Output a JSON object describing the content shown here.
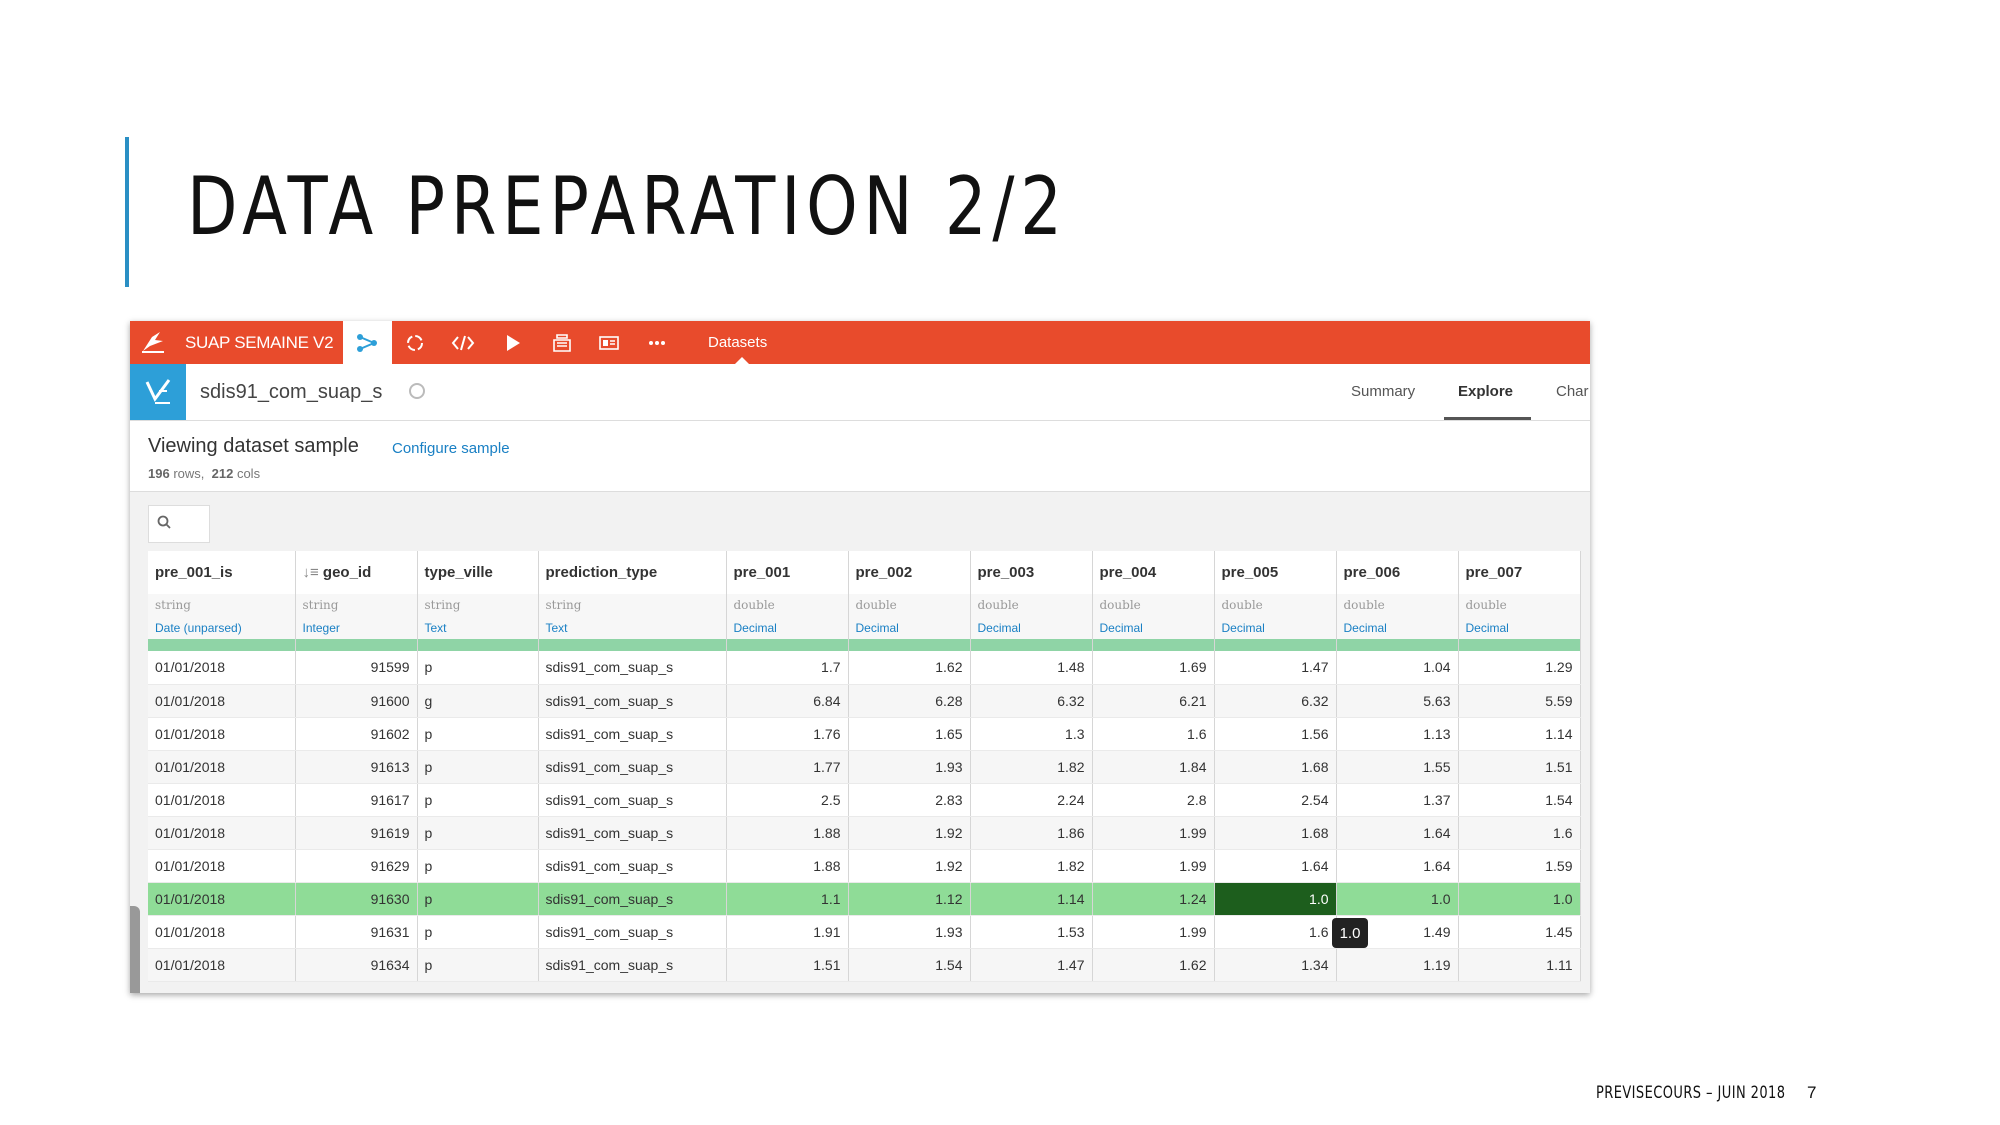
{
  "slide": {
    "title": "DATA PREPARATION 2/2",
    "footer": "PREVISECOURS – JUIN 2018",
    "page": "7"
  },
  "topbar": {
    "project": "SUAP SEMAINE V2",
    "datasets_label": "Datasets",
    "color": "#e84b2c"
  },
  "dataset": {
    "name": "sdis91_com_suap_s",
    "tabs": [
      "Summary",
      "Explore",
      "Char"
    ],
    "active_tab": "Explore"
  },
  "sample": {
    "title": "Viewing dataset sample",
    "configure_label": "Configure sample",
    "rows_count": "196",
    "rows_label": "rows,",
    "cols_count": "212",
    "cols_label": "cols"
  },
  "columns": [
    {
      "name": "pre_001_is",
      "type": "string",
      "meaning": "Date (unparsed)"
    },
    {
      "name": "geo_id",
      "type": "string",
      "meaning": "Integer"
    },
    {
      "name": "type_ville",
      "type": "string",
      "meaning": "Text"
    },
    {
      "name": "prediction_type",
      "type": "string",
      "meaning": "Text"
    },
    {
      "name": "pre_001",
      "type": "double",
      "meaning": "Decimal"
    },
    {
      "name": "pre_002",
      "type": "double",
      "meaning": "Decimal"
    },
    {
      "name": "pre_003",
      "type": "double",
      "meaning": "Decimal"
    },
    {
      "name": "pre_004",
      "type": "double",
      "meaning": "Decimal"
    },
    {
      "name": "pre_005",
      "type": "double",
      "meaning": "Decimal"
    },
    {
      "name": "pre_006",
      "type": "double",
      "meaning": "Decimal"
    },
    {
      "name": "pre_007",
      "type": "double",
      "meaning": "Decimal"
    }
  ],
  "rows": [
    [
      "01/01/2018",
      "91599",
      "p",
      "sdis91_com_suap_s",
      "1.7",
      "1.62",
      "1.48",
      "1.69",
      "1.47",
      "1.04",
      "1.29"
    ],
    [
      "01/01/2018",
      "91600",
      "g",
      "sdis91_com_suap_s",
      "6.84",
      "6.28",
      "6.32",
      "6.21",
      "6.32",
      "5.63",
      "5.59"
    ],
    [
      "01/01/2018",
      "91602",
      "p",
      "sdis91_com_suap_s",
      "1.76",
      "1.65",
      "1.3",
      "1.6",
      "1.56",
      "1.13",
      "1.14"
    ],
    [
      "01/01/2018",
      "91613",
      "p",
      "sdis91_com_suap_s",
      "1.77",
      "1.93",
      "1.82",
      "1.84",
      "1.68",
      "1.55",
      "1.51"
    ],
    [
      "01/01/2018",
      "91617",
      "p",
      "sdis91_com_suap_s",
      "2.5",
      "2.83",
      "2.24",
      "2.8",
      "2.54",
      "1.37",
      "1.54"
    ],
    [
      "01/01/2018",
      "91619",
      "p",
      "sdis91_com_suap_s",
      "1.88",
      "1.92",
      "1.86",
      "1.99",
      "1.68",
      "1.64",
      "1.6"
    ],
    [
      "01/01/2018",
      "91629",
      "p",
      "sdis91_com_suap_s",
      "1.88",
      "1.92",
      "1.82",
      "1.99",
      "1.64",
      "1.64",
      "1.59"
    ],
    [
      "01/01/2018",
      "91630",
      "p",
      "sdis91_com_suap_s",
      "1.1",
      "1.12",
      "1.14",
      "1.24",
      "1.0",
      "1.0",
      "1.0"
    ],
    [
      "01/01/2018",
      "91631",
      "p",
      "sdis91_com_suap_s",
      "1.91",
      "1.93",
      "1.53",
      "1.99",
      "1.6",
      "1.49",
      "1.45"
    ],
    [
      "01/01/2018",
      "91634",
      "p",
      "sdis91_com_suap_s",
      "1.51",
      "1.54",
      "1.47",
      "1.62",
      "1.34",
      "1.19",
      "1.11"
    ]
  ],
  "selected_row": 7,
  "focused_cell": {
    "row": 7,
    "col": 8
  },
  "tooltip": "1.0"
}
